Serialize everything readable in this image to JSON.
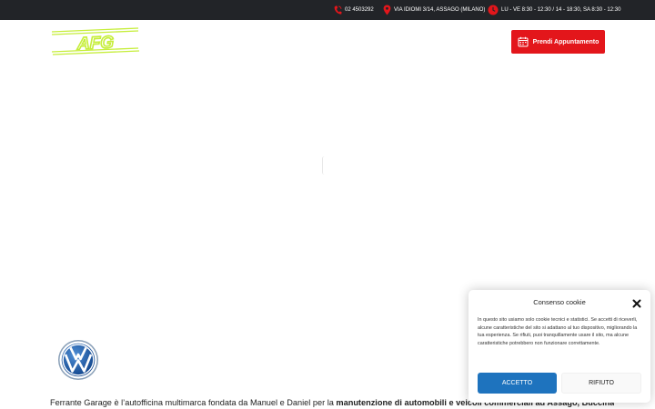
{
  "topbar": {
    "phone": "02 4503292",
    "address": "VIA IDIOMI 3/14, ASSAGO (MILANO)",
    "hours": "LU - VE 8:30 - 12:30 / 14 - 18:30, SA 8:30 - 12:30"
  },
  "header": {
    "logo_text": "AFG",
    "cta_label": "Prendi Appuntamento"
  },
  "intro": {
    "text_plain": "Ferrante Garage è l’autofficina multimarca fondata da Manuel e Daniel per la ",
    "text_bold": "manutenzione di automobili e veicoli commerciali ad Assago, Buccinasco,"
  },
  "cookie": {
    "title": "Consenso cookie",
    "body": "In questo sito usiamo solo cookie tecnici e statistici. Se accetti di riceverli, alcune caratteristiche del sito si adattano al tuo dispositivo, migliorando la tua esperienza. Se rifiuti, puoi tranquillamente usare il sito, ma alcune caratteristiche potrebbero non funzionare correttamente.",
    "accept_label": "ACCETTO",
    "reject_label": "RIFIUTO"
  },
  "colors": {
    "topbar_bg": "#222428",
    "brand_red": "#e3161b",
    "logo_green": "#c6ee3b",
    "accept_blue": "#1e73be"
  },
  "icons": [
    "phone-icon",
    "location-pin-icon",
    "clock-icon",
    "calendar-icon",
    "close-icon",
    "volkswagen-logo"
  ]
}
